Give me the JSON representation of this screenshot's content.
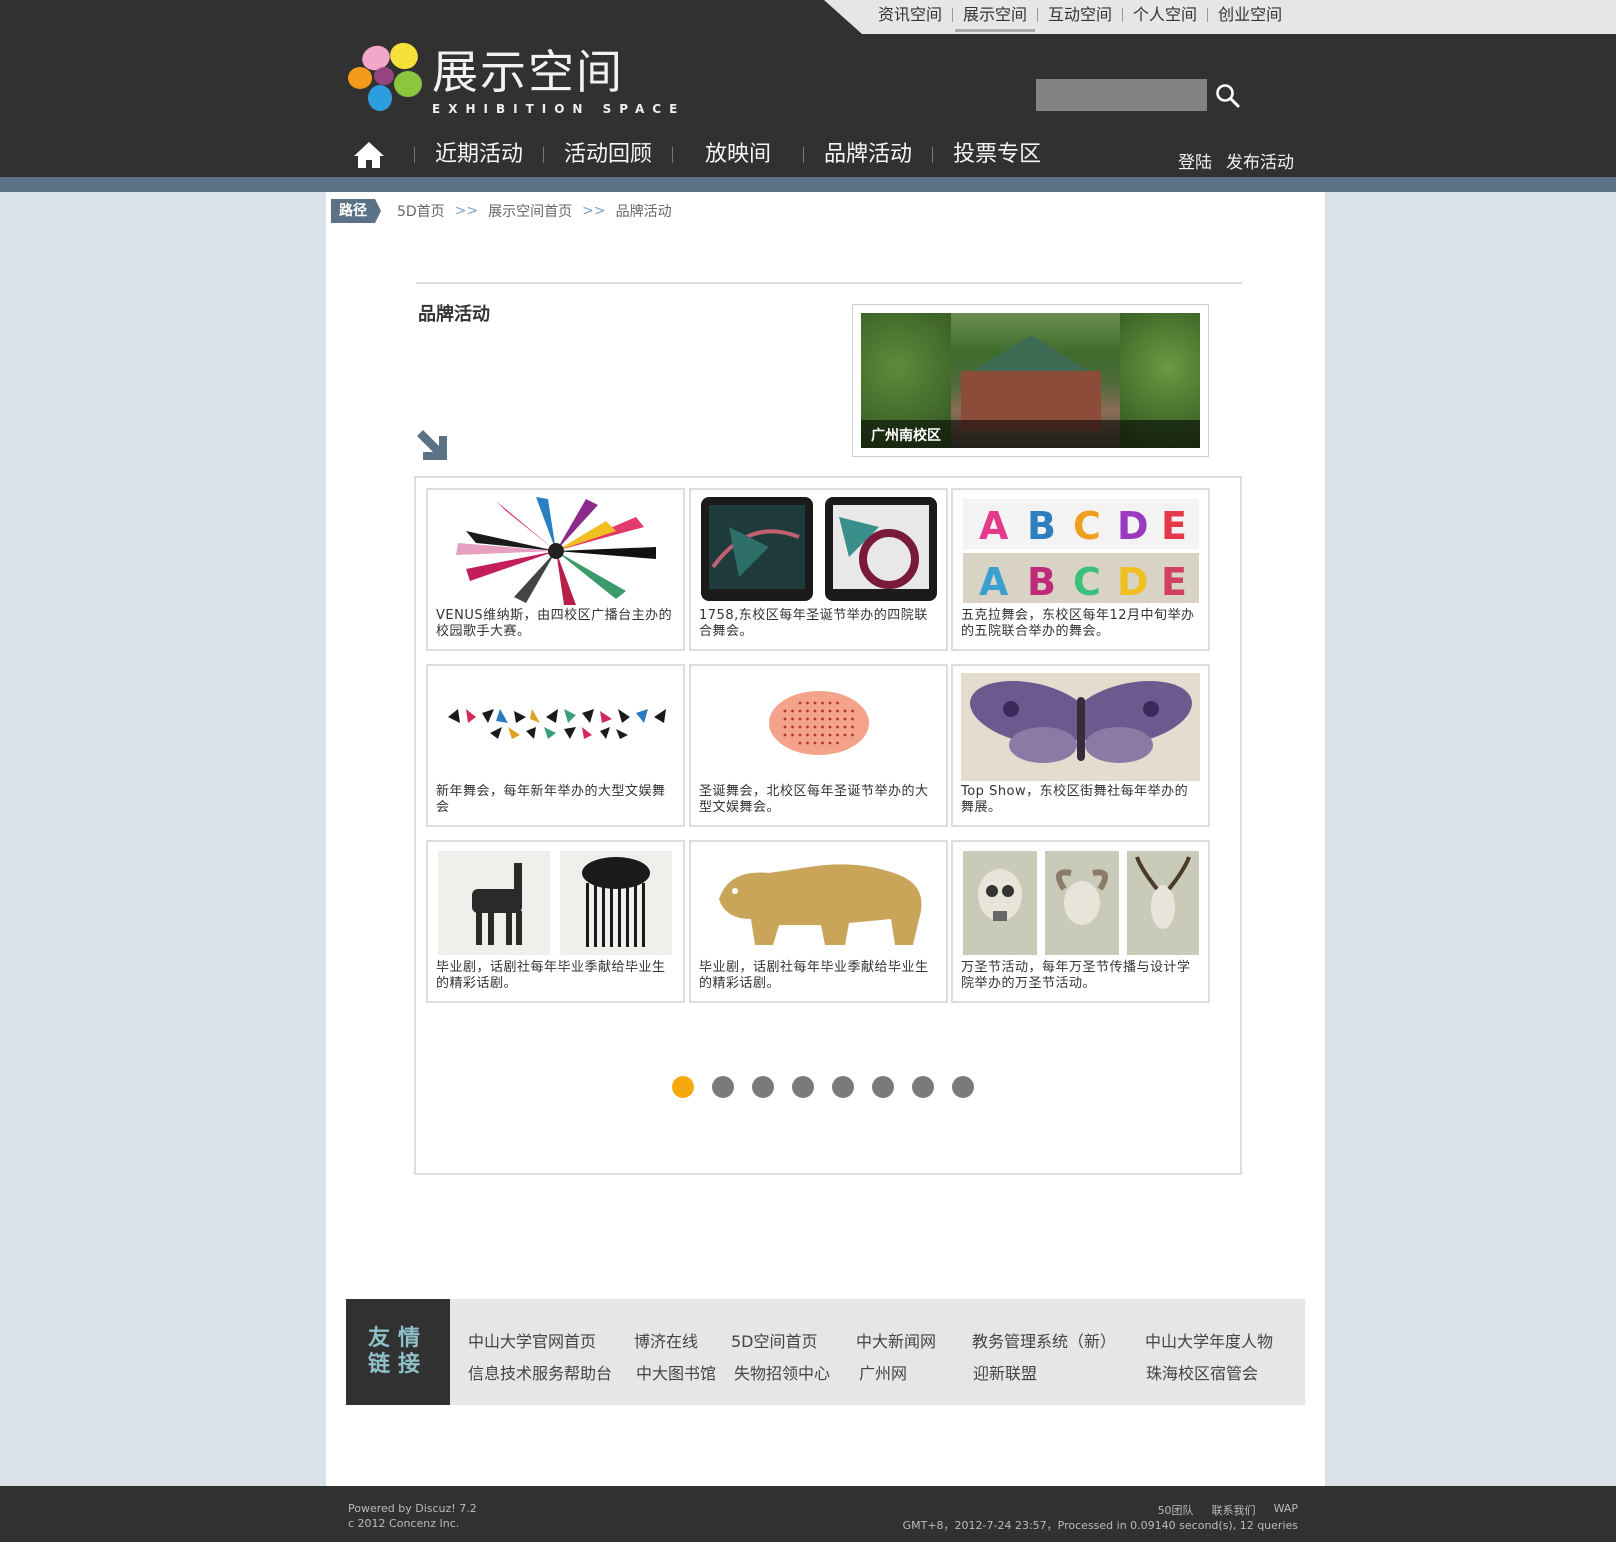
{
  "topnav": [
    "资讯空间",
    "展示空间",
    "互动空间",
    "个人空间",
    "创业空间"
  ],
  "logo": {
    "title": "展示空间",
    "subtitle": "EXHIBITION SPACE"
  },
  "search": {
    "placeholder": ""
  },
  "mainnav": [
    "近期活动",
    "活动回顾",
    "放映间",
    "品牌活动",
    "投票专区"
  ],
  "usernav": {
    "login": "登陆",
    "publish": "发布活动"
  },
  "breadcrumb": {
    "tag": "路径",
    "items": [
      "5D首页",
      "展示空间首页",
      "品牌活动"
    ],
    "separator": ">>"
  },
  "section_title": "品牌活动",
  "slider": {
    "caption": "广州南校区",
    "dots": 4,
    "active": 0
  },
  "gallery": [
    {
      "caption": "VENUS维纳斯，由四校区广播台主办的校园歌手大赛。"
    },
    {
      "caption": "1758,东校区每年圣诞节举办的四院联合舞会。"
    },
    {
      "caption": "五克拉舞会，东校区每年12月中旬举办的五院联合举办的舞会。"
    },
    {
      "caption": "新年舞会，每年新年举办的大型文娱舞会"
    },
    {
      "caption": "圣诞舞会，北校区每年圣诞节举办的大型文娱舞会。"
    },
    {
      "caption": "Top Show，东校区街舞社每年举办的舞展。"
    },
    {
      "caption": "毕业剧，话剧社每年毕业季献给毕业生的精彩话剧。"
    },
    {
      "caption": "毕业剧，话剧社每年毕业季献给毕业生的精彩话剧。"
    },
    {
      "caption": "万圣节活动，每年万圣节传播与设计学院举办的万圣节活动。"
    }
  ],
  "pager": {
    "count": 8,
    "active": 0
  },
  "links": {
    "tag_line1": "友情",
    "tag_line2": "链接",
    "row1": [
      "中山大学官网首页",
      "博济在线",
      "5D空间首页",
      "中大新闻网",
      "教务管理系统（新）",
      "中山大学年度人物"
    ],
    "row2": [
      "信息技术服务帮助台",
      "中大图书馆",
      "失物招领中心",
      "广州网",
      "迎新联盟",
      "珠海校区宿管会"
    ]
  },
  "footer": {
    "powered": "Powered by Discuz! 7.2",
    "copyright": "c  2012 Concenz Inc.",
    "links": [
      "50团队",
      "联系我们",
      "WAP"
    ],
    "status": "GMT+8，2012-7-24 23:57，Processed in 0.09140 second(s), 12 queries"
  },
  "colors": {
    "header": "#323132",
    "accent": "#f5a90c",
    "bluebar": "#5a7186",
    "background": "#dae1e9"
  }
}
